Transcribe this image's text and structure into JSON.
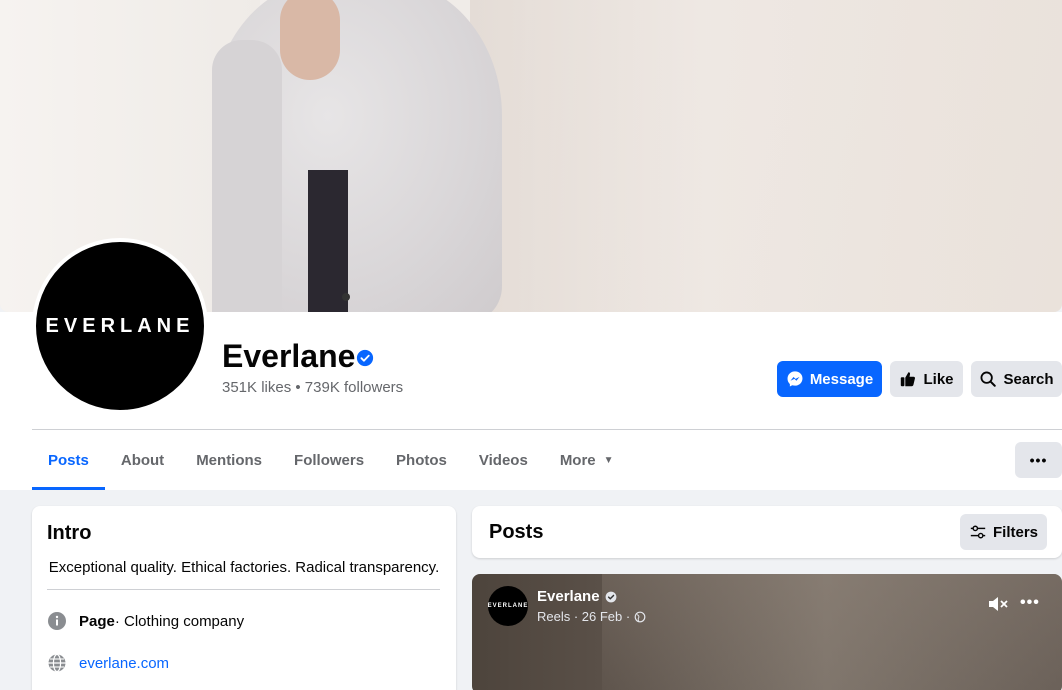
{
  "page": {
    "name": "Everlane",
    "avatar_text": "EVERLANE",
    "stats": "351K likes • 739K followers",
    "verified_icon": "verified-badge-icon"
  },
  "actions": {
    "message_label": "Message",
    "like_label": "Like",
    "search_label": "Search",
    "more_dots": "•••"
  },
  "tabs": [
    {
      "label": "Posts",
      "active": true
    },
    {
      "label": "About"
    },
    {
      "label": "Mentions"
    },
    {
      "label": "Followers"
    },
    {
      "label": "Photos"
    },
    {
      "label": "Videos"
    },
    {
      "label": "More"
    }
  ],
  "intro": {
    "title": "Intro",
    "bio": "Exceptional quality. Ethical factories. Radical transparency.",
    "page_label": "Page",
    "page_category": " · Clothing company",
    "website": "everlane.com"
  },
  "posts": {
    "title": "Posts",
    "filters_label": "Filters",
    "reel": {
      "author": "Everlane",
      "avatar_text": "EVERLANE",
      "meta": "Reels · 26 Feb ·",
      "dots": "•••"
    }
  },
  "colors": {
    "accent": "#0866ff",
    "button_gray": "#e4e6eb",
    "page_bg": "#f0f2f5"
  }
}
